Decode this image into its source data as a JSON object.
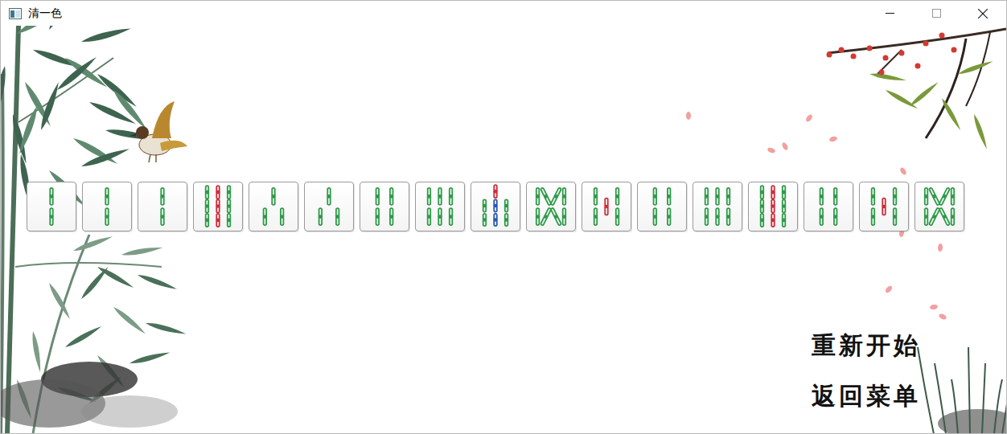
{
  "window": {
    "title": "清一色"
  },
  "hand": {
    "suit": "bamboo",
    "tiles": [
      {
        "rank": 2
      },
      {
        "rank": 2
      },
      {
        "rank": 2
      },
      {
        "rank": 9
      },
      {
        "rank": 3
      },
      {
        "rank": 3
      },
      {
        "rank": 4
      },
      {
        "rank": 6
      },
      {
        "rank": 7
      },
      {
        "rank": 8
      },
      {
        "rank": 5
      },
      {
        "rank": 4
      },
      {
        "rank": 6
      },
      {
        "rank": 9
      },
      {
        "rank": 4
      },
      {
        "rank": 5
      },
      {
        "rank": 8
      }
    ]
  },
  "menu": [
    {
      "label": "重新开始"
    },
    {
      "label": "返回菜单"
    }
  ]
}
